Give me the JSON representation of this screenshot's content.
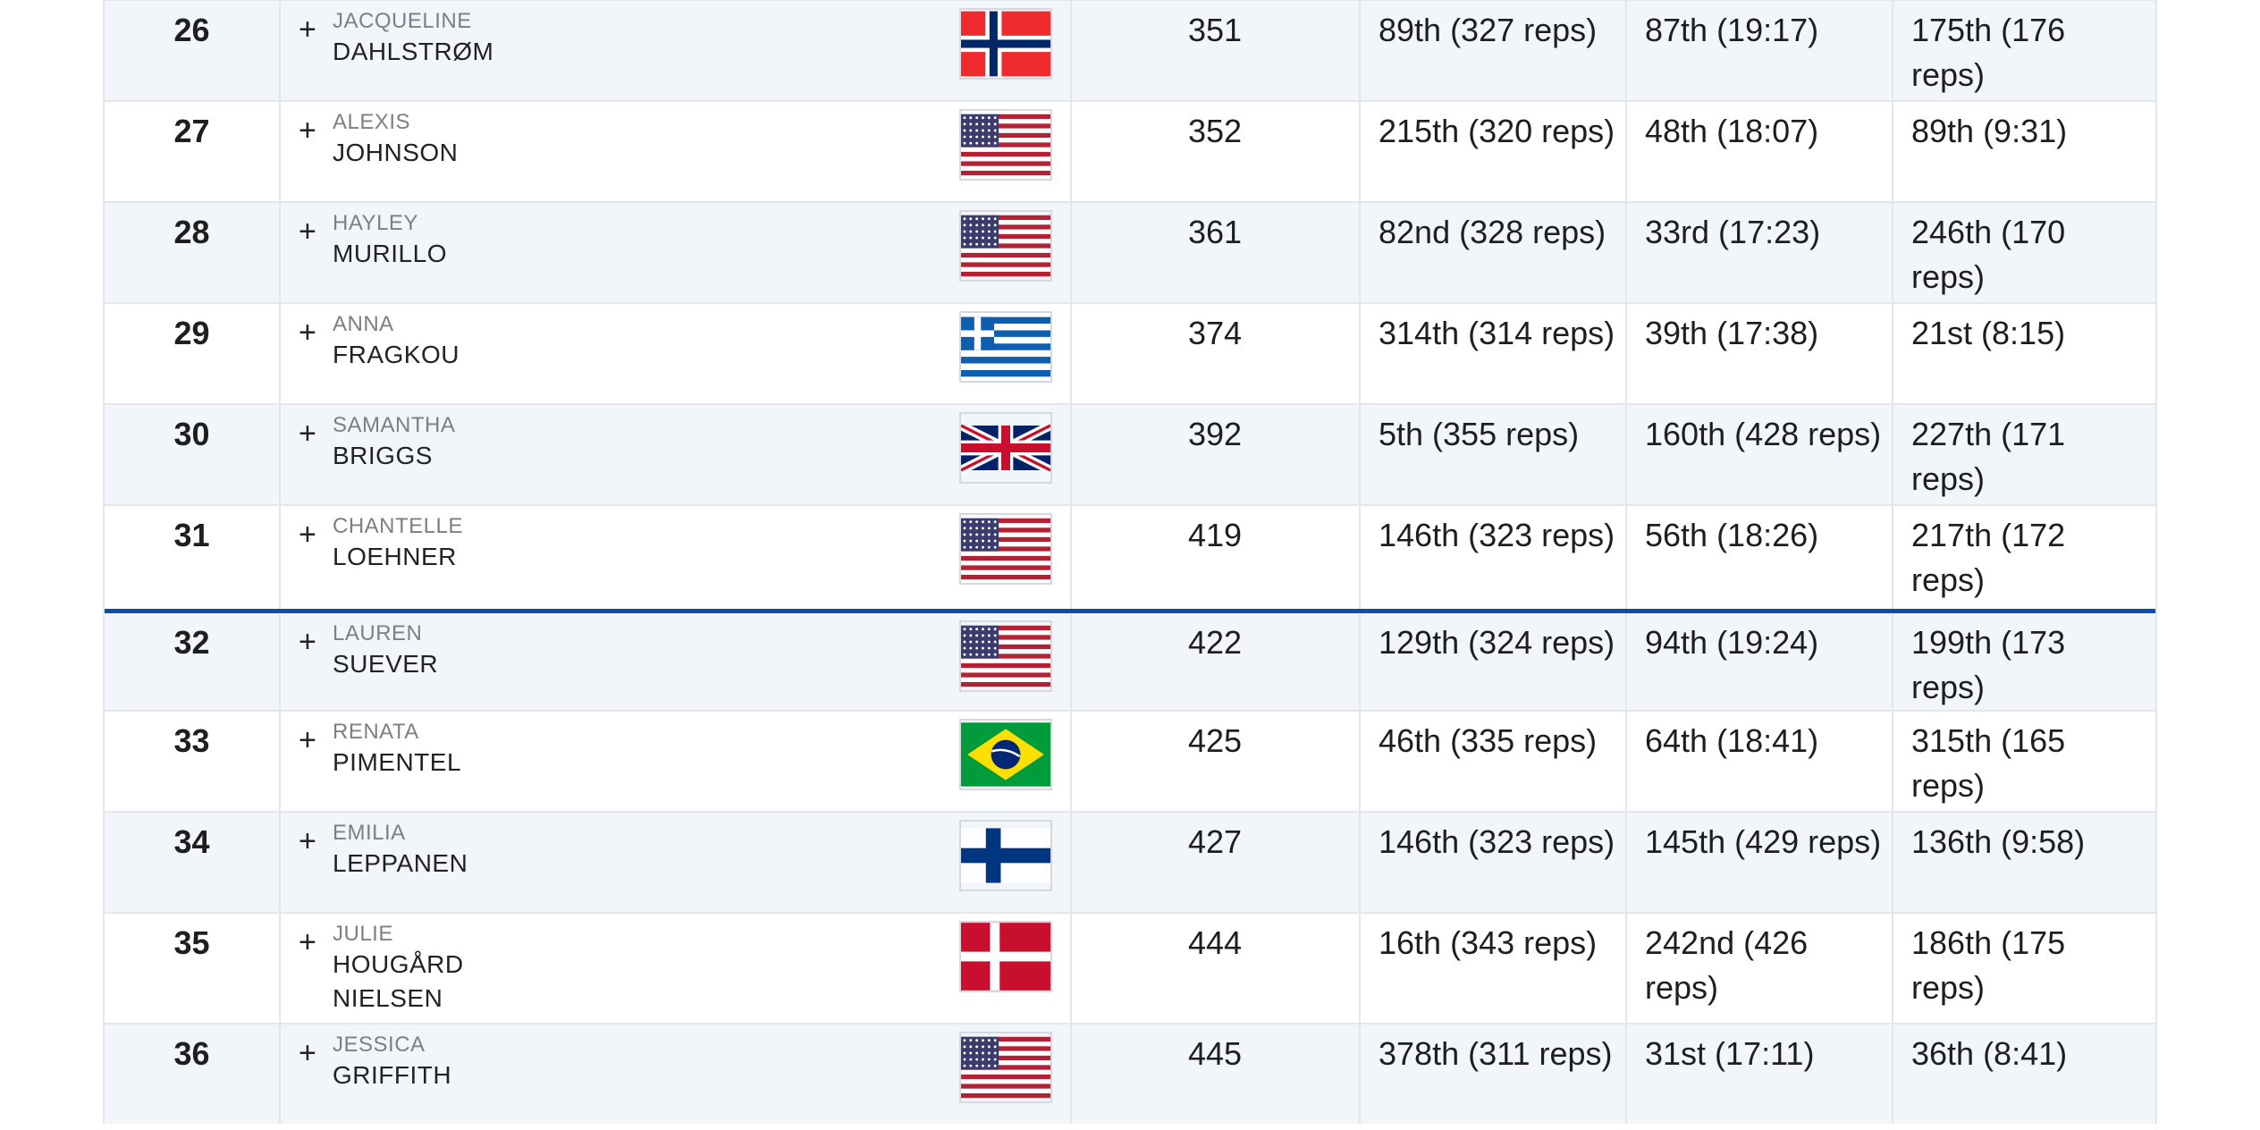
{
  "leaderboard": {
    "rows": [
      {
        "rank": "26",
        "first": "JACQUELINE",
        "last": "DAHLSTRØM",
        "last2": "",
        "flag": "norway-flag",
        "points": "351",
        "e1": "89th (327 reps)",
        "e2": "87th (19:17)",
        "e3": "175th (176 reps)"
      },
      {
        "rank": "27",
        "first": "ALEXIS",
        "last": "JOHNSON",
        "last2": "",
        "flag": "usa-flag",
        "points": "352",
        "e1": "215th (320 reps)",
        "e2": "48th (18:07)",
        "e3": "89th (9:31)"
      },
      {
        "rank": "28",
        "first": "HAYLEY",
        "last": "MURILLO",
        "last2": "",
        "flag": "usa-flag",
        "points": "361",
        "e1": "82nd (328 reps)",
        "e2": "33rd (17:23)",
        "e3": "246th (170 reps)"
      },
      {
        "rank": "29",
        "first": "ANNA",
        "last": "FRAGKOU",
        "last2": "",
        "flag": "greece-flag",
        "points": "374",
        "e1": "314th (314 reps)",
        "e2": "39th (17:38)",
        "e3": "21st (8:15)"
      },
      {
        "rank": "30",
        "first": "SAMANTHA",
        "last": "BRIGGS",
        "last2": "",
        "flag": "uk-flag",
        "points": "392",
        "e1": "5th (355 reps)",
        "e2": "160th (428 reps)",
        "e3": "227th (171 reps)"
      },
      {
        "rank": "31",
        "first": "CHANTELLE",
        "last": "LOEHNER",
        "last2": "",
        "flag": "usa-flag",
        "points": "419",
        "e1": "146th (323 reps)",
        "e2": "56th (18:26)",
        "e3": "217th (172 reps)"
      },
      {
        "rank": "32",
        "first": "LAUREN",
        "last": "SUEVER",
        "last2": "",
        "flag": "usa-flag",
        "points": "422",
        "e1": "129th (324 reps)",
        "e2": "94th (19:24)",
        "e3": "199th (173 reps)"
      },
      {
        "rank": "33",
        "first": "RENATA",
        "last": "PIMENTEL",
        "last2": "",
        "flag": "brazil-flag",
        "points": "425",
        "e1": "46th (335 reps)",
        "e2": "64th (18:41)",
        "e3": "315th (165 reps)"
      },
      {
        "rank": "34",
        "first": "EMILIA",
        "last": "LEPPANEN",
        "last2": "",
        "flag": "finland-flag",
        "points": "427",
        "e1": "146th (323 reps)",
        "e2": "145th (429 reps)",
        "e3": "136th (9:58)"
      },
      {
        "rank": "35",
        "first": "JULIE",
        "last": "HOUGÅRD",
        "last2": "NIELSEN",
        "flag": "denmark-flag",
        "points": "444",
        "e1": "16th (343 reps)",
        "e2": "242nd (426 reps)",
        "e3": "186th (175 reps)"
      },
      {
        "rank": "36",
        "first": "JESSICA",
        "last": "GRIFFITH",
        "last2": "",
        "flag": "usa-flag",
        "points": "445",
        "e1": "378th (311 reps)",
        "e2": "31st (17:11)",
        "e3": "36th (8:41)"
      }
    ],
    "expand_symbol": "+",
    "colors": {
      "cutline": "#0a4fb0",
      "alt_row": "#f2f6fb",
      "border": "#e3e6ea"
    }
  }
}
